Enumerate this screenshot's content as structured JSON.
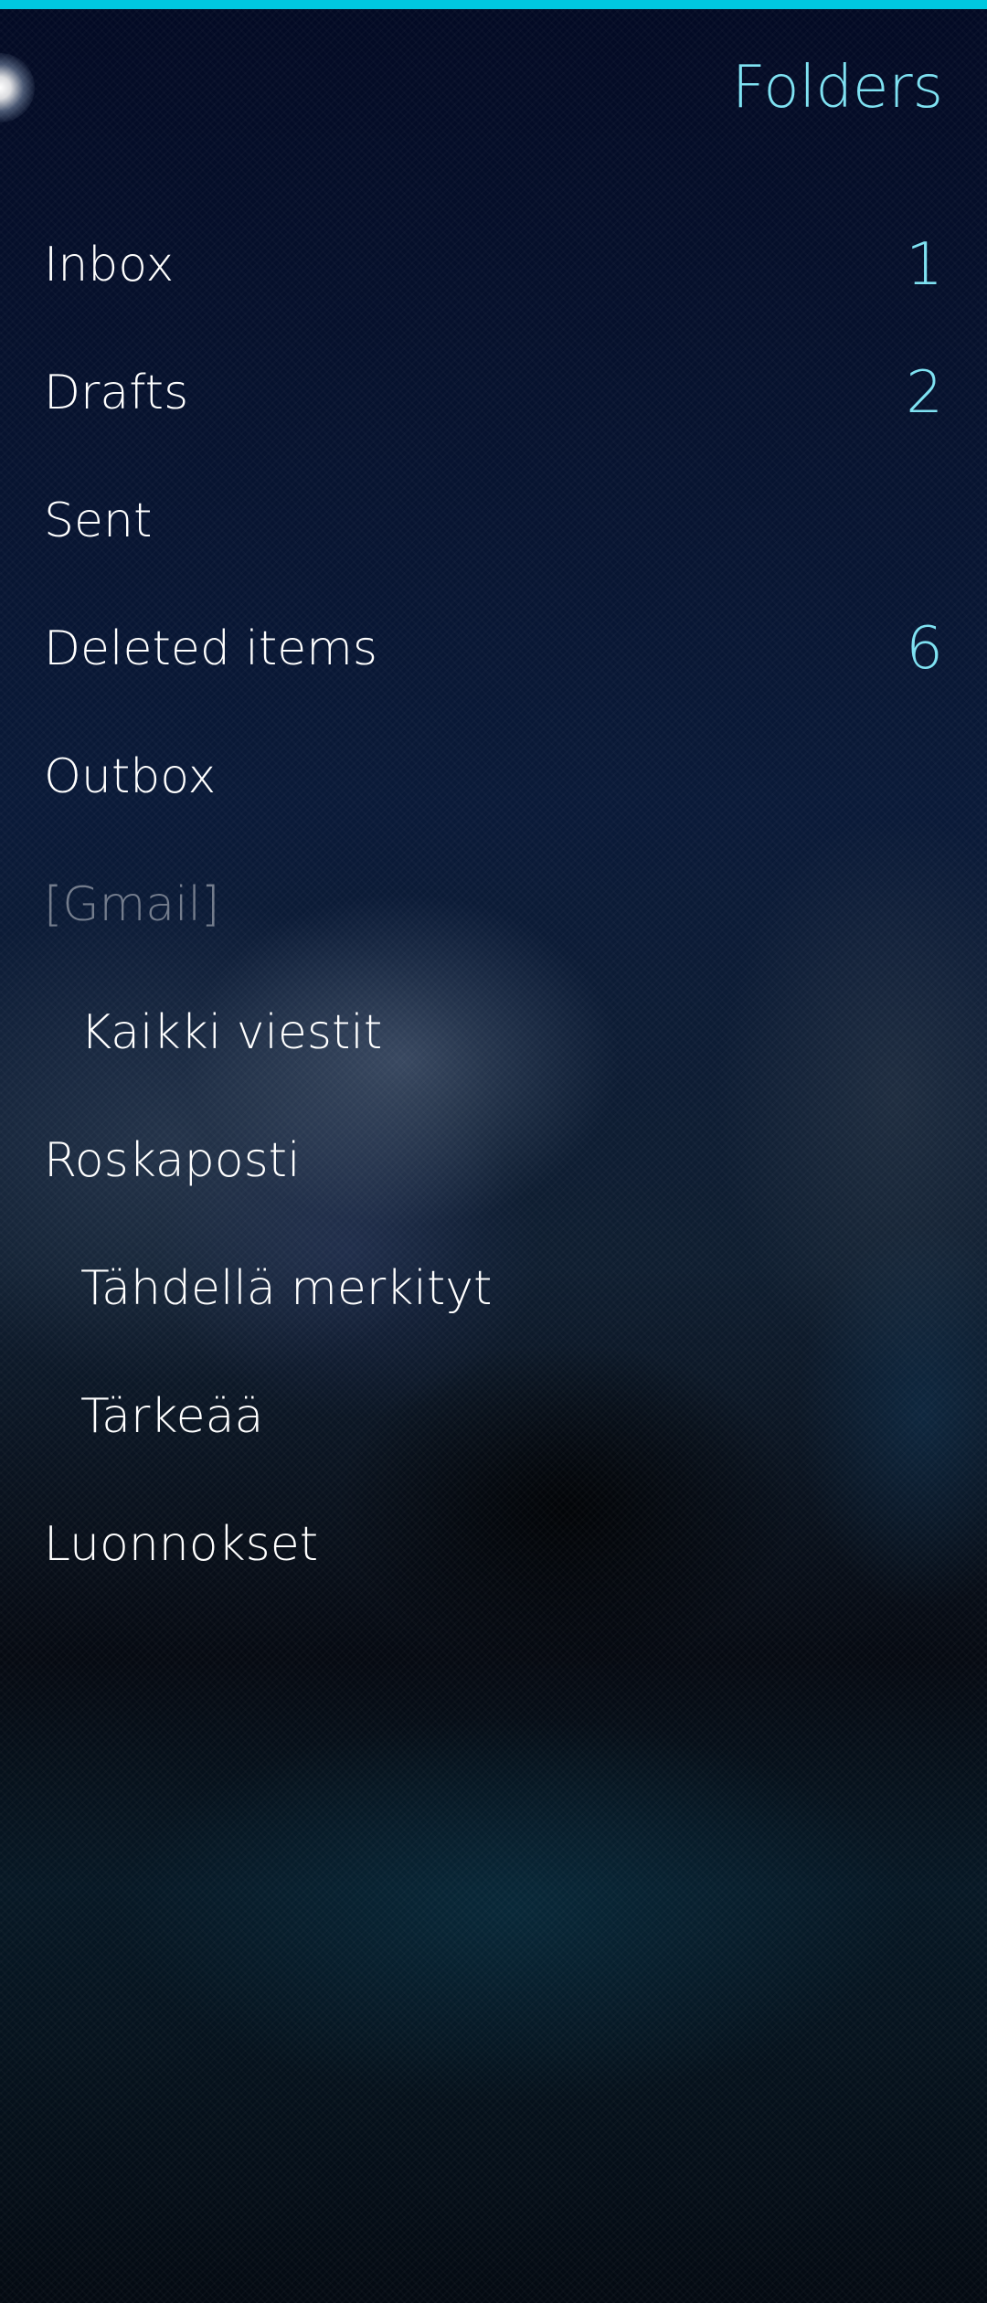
{
  "header": {
    "title": "Folders",
    "accent_color": "#00c8e0",
    "title_color": "#7fe2f2"
  },
  "folders": [
    {
      "label": "Inbox",
      "count": "1"
    },
    {
      "label": "Drafts",
      "count": "2"
    },
    {
      "label": "Sent",
      "count": ""
    },
    {
      "label": "Deleted items",
      "count": "6"
    },
    {
      "label": "Outbox",
      "count": ""
    },
    {
      "label": "[Gmail]",
      "count": ""
    },
    {
      "label": "Kaikki viestit",
      "count": ""
    },
    {
      "label": "Roskaposti",
      "count": ""
    },
    {
      "label": "Tähdellä merkityt",
      "count": ""
    },
    {
      "label": "Tärkeää",
      "count": ""
    },
    {
      "label": "Luonnokset",
      "count": ""
    }
  ]
}
